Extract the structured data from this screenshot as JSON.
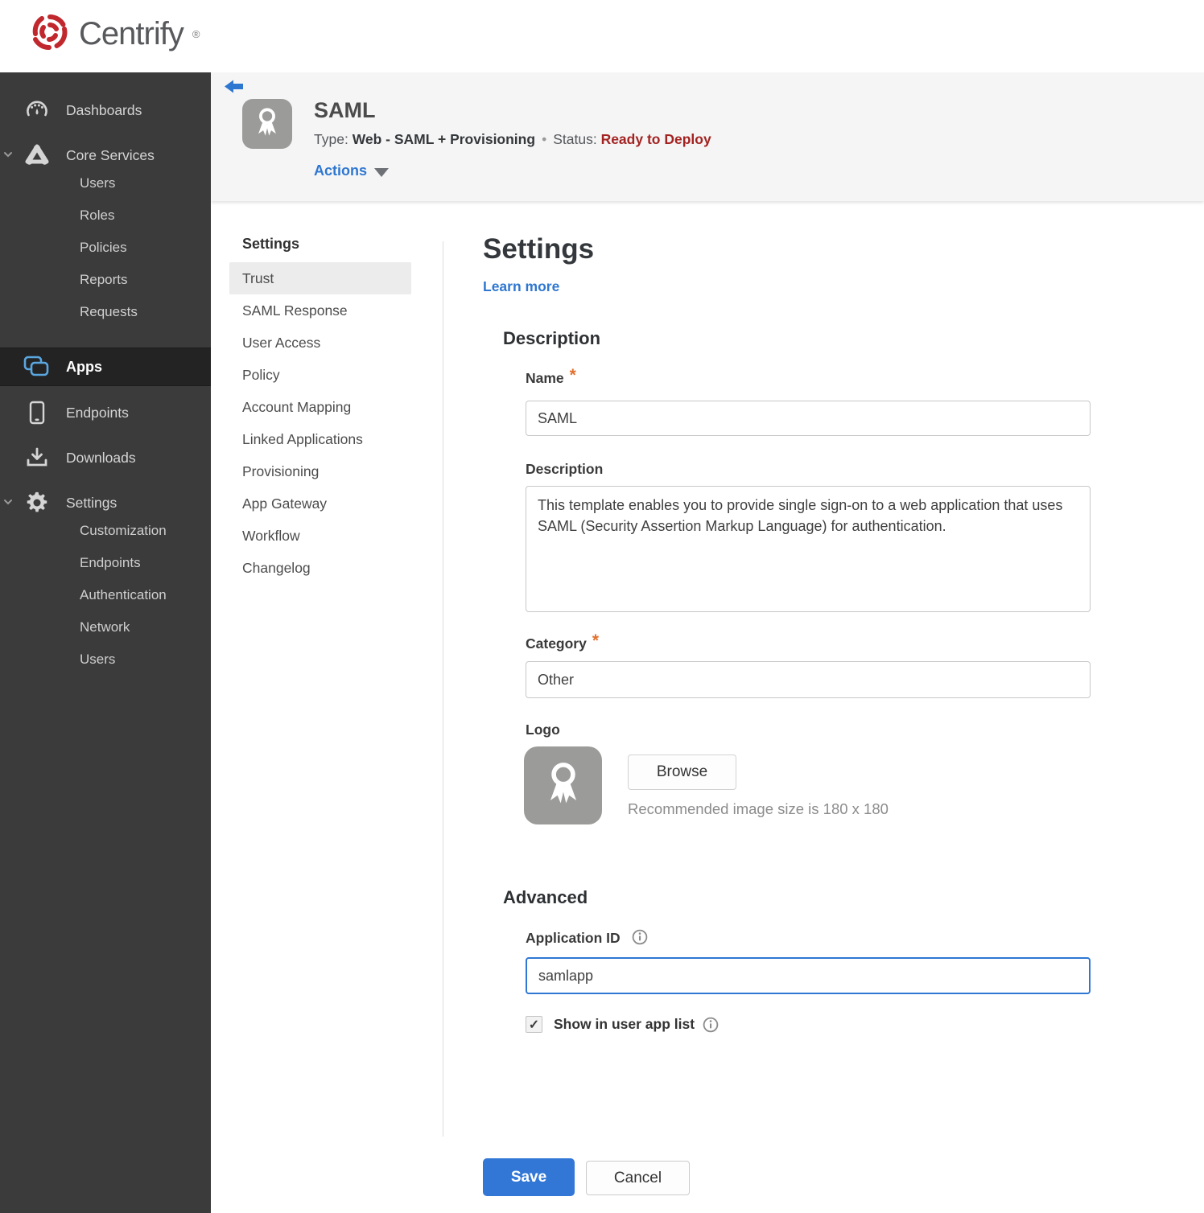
{
  "brand": {
    "name": "Centrify",
    "registered": "®"
  },
  "colors": {
    "brand_red": "#c1282d",
    "sidebar_bg": "#3b3b3b",
    "sidebar_active_bg": "#232323",
    "header_band_bg": "#f5f5f6",
    "link_blue": "#2e77d0",
    "save_blue": "#3277d6",
    "status_red": "#a32321",
    "required_orange": "#e0712e",
    "selected_nav_bg": "#ececec",
    "apps_icon_blue": "#5aa7e0"
  },
  "icons": [
    "centrify-logo-icon",
    "gauge-icon",
    "core-services-icon",
    "chevron-down-icon",
    "apps-icon",
    "device-icon",
    "download-icon",
    "gear-icon",
    "back-arrow-icon",
    "ribbon-icon",
    "dropdown-triangle-icon",
    "info-icon",
    "checkbox-check-icon"
  ],
  "sidebar": {
    "dashboards": "Dashboards",
    "core_services": "Core Services",
    "core_children": [
      "Users",
      "Roles",
      "Policies",
      "Reports",
      "Requests"
    ],
    "apps": "Apps",
    "endpoints": "Endpoints",
    "downloads": "Downloads",
    "settings": "Settings",
    "settings_children": [
      "Customization",
      "Endpoints",
      "Authentication",
      "Network",
      "Users"
    ]
  },
  "header": {
    "app_title": "SAML",
    "type_label": "Type:",
    "type_value": "Web - SAML + Provisioning",
    "separator": "•",
    "status_label": "Status:",
    "status_value": "Ready to Deploy",
    "actions_label": "Actions"
  },
  "subnav": {
    "heading": "Settings",
    "selected": "Trust",
    "items": [
      "Trust",
      "SAML Response",
      "User Access",
      "Policy",
      "Account Mapping",
      "Linked Applications",
      "Provisioning",
      "App Gateway",
      "Workflow",
      "Changelog"
    ]
  },
  "main": {
    "title": "Settings",
    "learn_more": "Learn more",
    "description_section": {
      "heading": "Description",
      "name_label": "Name",
      "name_required": "*",
      "name_value": "SAML",
      "description_label": "Description",
      "description_value": "This template enables you to provide single sign-on to a web application that uses SAML (Security Assertion Markup Language) for authentication.",
      "category_label": "Category",
      "category_required": "*",
      "category_value": "Other",
      "logo_label": "Logo",
      "browse_label": "Browse",
      "logo_hint": "Recommended image size is 180 x 180"
    },
    "advanced_section": {
      "heading": "Advanced",
      "application_id_label": "Application ID",
      "application_id_value": "samlapp",
      "show_in_user_app_list_label": "Show in user app list",
      "show_in_user_app_list_checked": "✓"
    },
    "save_label": "Save",
    "cancel_label": "Cancel"
  }
}
